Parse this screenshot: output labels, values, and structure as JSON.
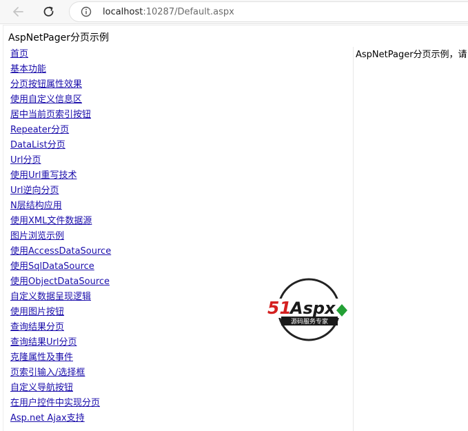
{
  "browser": {
    "url_host": "localhost",
    "url_rest": ":10287/Default.aspx",
    "icons": {
      "back": "arrow-left-icon",
      "reload": "reload-icon",
      "site_info": "info-circle-icon"
    }
  },
  "page": {
    "title": "AspNetPager分页示例",
    "content_text": "AspNetPager分页示例，请",
    "link_color": "#1a0dab",
    "menu": [
      "首页",
      "基本功能",
      "分页按钮属性效果",
      "使用自定义信息区",
      "居中当前页索引按钮",
      "Repeater分页",
      "DataList分页",
      "Url分页",
      "使用Url重写技术",
      "Url逆向分页",
      "N层结构应用",
      "使用XML文件数据源",
      "图片浏览示例",
      "使用AccessDataSource",
      "使用SqlDataSource",
      "使用ObjectDataSource",
      "自定义数据呈现逻辑",
      "使用图片按钮",
      "查询结果分页",
      "查询结果Url分页",
      "克隆属性及事件",
      "页索引输入/选择框",
      "自定义导航按钮",
      "在用户控件中实现分页",
      "Asp.net Ajax支持"
    ]
  },
  "watermark": {
    "brand_51": "51",
    "brand_aspx": "Aspx",
    "tagline": "源码服务专家",
    "color_red": "#d42020",
    "color_green": "#23a035"
  }
}
